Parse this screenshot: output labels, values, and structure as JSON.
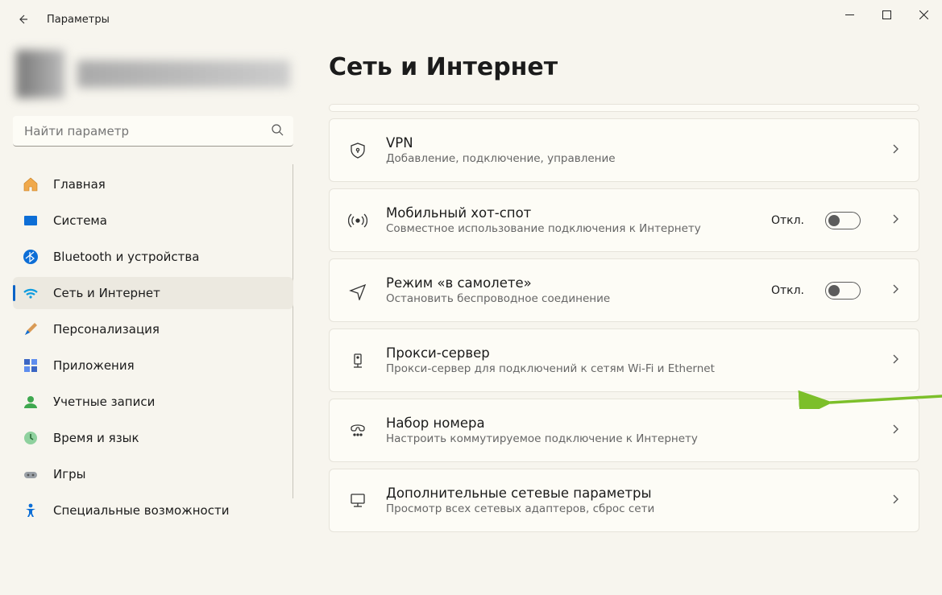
{
  "app_title": "Параметры",
  "search": {
    "placeholder": "Найти параметр"
  },
  "sidebar": {
    "items": [
      {
        "label": "Главная"
      },
      {
        "label": "Система"
      },
      {
        "label": "Bluetooth и устройства"
      },
      {
        "label": "Сеть и Интернет"
      },
      {
        "label": "Персонализация"
      },
      {
        "label": "Приложения"
      },
      {
        "label": "Учетные записи"
      },
      {
        "label": "Время и язык"
      },
      {
        "label": "Игры"
      },
      {
        "label": "Специальные возможности"
      }
    ]
  },
  "page": {
    "title": "Сеть и Интернет",
    "cards": [
      {
        "title": "VPN",
        "subtitle": "Добавление, подключение, управление"
      },
      {
        "title": "Мобильный хот-спот",
        "subtitle": "Совместное использование подключения к Интернету",
        "state": "Откл."
      },
      {
        "title": "Режим «в самолете»",
        "subtitle": "Остановить беспроводное соединение",
        "state": "Откл."
      },
      {
        "title": "Прокси-сервер",
        "subtitle": "Прокси-сервер для подключений к сетям Wi-Fi и Ethernet"
      },
      {
        "title": "Набор номера",
        "subtitle": "Настроить коммутируемое подключение к Интернету"
      },
      {
        "title": "Дополнительные сетевые параметры",
        "subtitle": "Просмотр всех сетевых адаптеров, сброс сети"
      }
    ]
  }
}
